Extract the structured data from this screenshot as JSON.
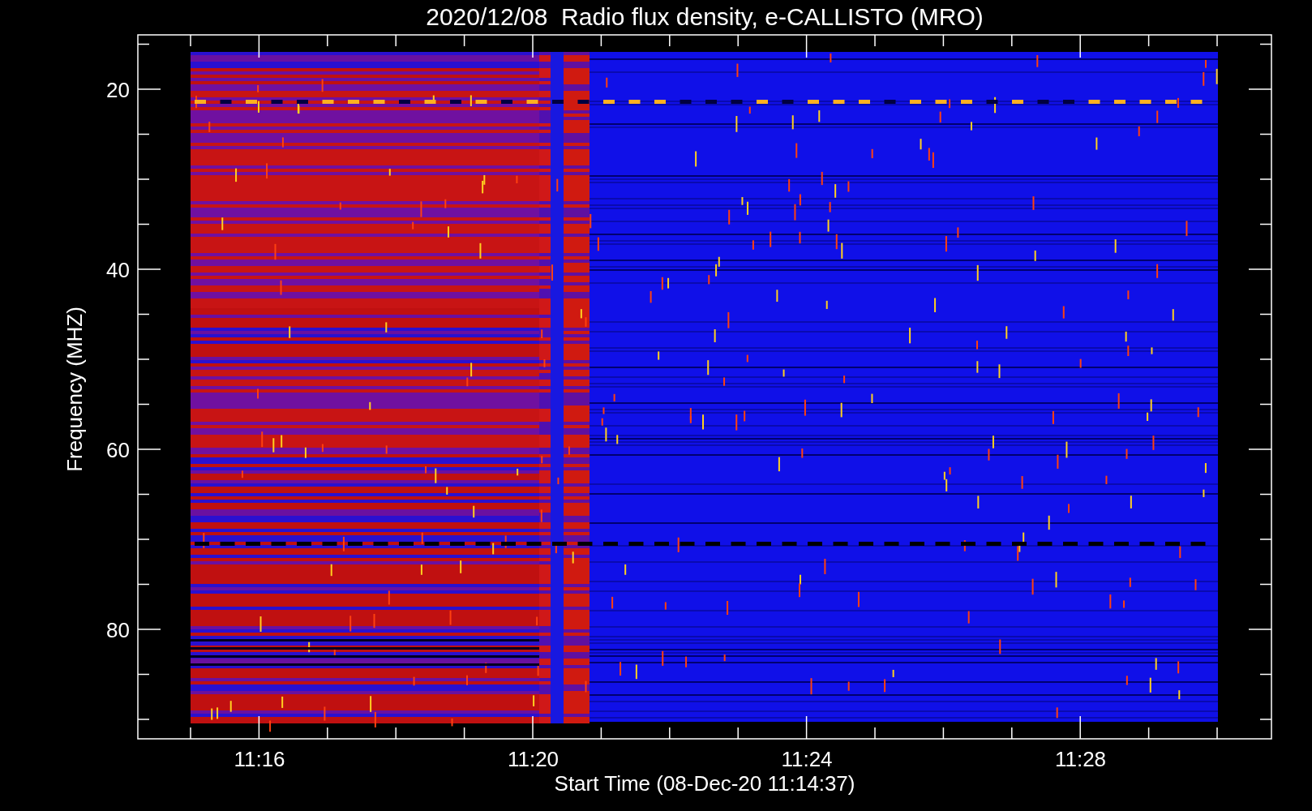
{
  "title": "2020/12/08  Radio flux density, e-CALLISTO (MRO)",
  "y_axis": {
    "label": "Frequency (MHZ)",
    "ticks": [
      "20",
      "40",
      "60",
      "80"
    ]
  },
  "x_axis": {
    "label": "Start Time (08-Dec-20 11:14:37)",
    "ticks": [
      "11:16",
      "11:20",
      "11:24",
      "11:28"
    ]
  }
}
